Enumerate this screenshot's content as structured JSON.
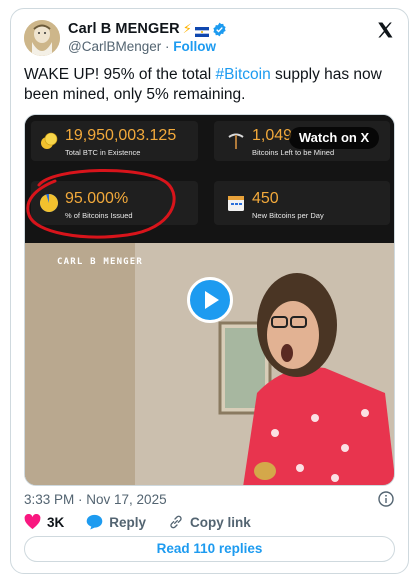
{
  "author": {
    "display_name": "Carl B MENGER",
    "name_emojis": "⚡",
    "handle": "@CarlBMenger",
    "separator": " · ",
    "follow_label": "Follow"
  },
  "tweet": {
    "text_before": "WAKE UP! 95% of the total ",
    "hashtag": "#Bitcoin",
    "text_after": " supply has now been mined, only 5% remaining."
  },
  "media": {
    "watch_label": "Watch on X",
    "watermark": "CARL B MENGER",
    "stats": [
      {
        "value": "19,950,003.125",
        "label": "Total BTC in Existence"
      },
      {
        "value": "1,049",
        "label": "Bitcoins Left to be Mined"
      },
      {
        "value": "95.000%",
        "label": "% of Bitcoins Issued"
      },
      {
        "value": "450",
        "label": "New Bitcoins per Day"
      }
    ],
    "issued_fraction": 0.95
  },
  "footer": {
    "timestamp": "3:33 PM · Nov 17, 2025",
    "likes": "3K",
    "reply_label": "Reply",
    "copy_link_label": "Copy link",
    "read_replies": "Read 110 replies"
  },
  "colors": {
    "accent": "#1d9bf0",
    "like": "#f91880",
    "stat_value": "#f2a93b",
    "highlight_circle": "#d8141b"
  }
}
